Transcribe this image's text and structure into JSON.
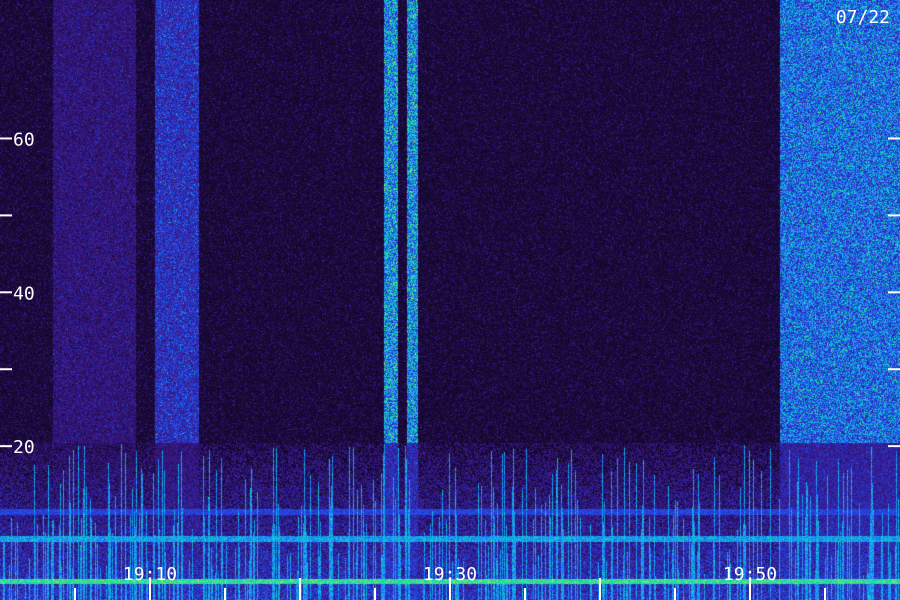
{
  "chart_data": {
    "type": "heatmap",
    "title": "",
    "date_label": "07/22",
    "xlabel": "",
    "ylabel": "",
    "y_axis": {
      "range": [
        0,
        78
      ],
      "tick_labels": [
        "60",
        "40",
        "20"
      ],
      "tick_values": [
        60,
        50,
        40,
        30,
        20
      ]
    },
    "x_axis": {
      "range": [
        "19:00",
        "20:00"
      ],
      "tick_labels": [
        "19:10",
        "19:30",
        "19:50"
      ],
      "tick_label_values": [
        10,
        30,
        50
      ],
      "major_tick_values": [
        10,
        20,
        30,
        40,
        50
      ],
      "minor_tick_values": [
        5,
        15,
        25,
        35,
        45,
        55
      ]
    },
    "colormap": [
      "#000000",
      "#1a0a3a",
      "#3a1580",
      "#2a30c0",
      "#2060ff",
      "#10c8d8",
      "#30e080",
      "#d0ff40"
    ],
    "intensity_bands": [
      {
        "time_start": 3.5,
        "time_end": 9.0,
        "level": 0.35
      },
      {
        "time_start": 10.3,
        "time_end": 13.2,
        "level": 0.55
      },
      {
        "time_start": 25.6,
        "time_end": 26.5,
        "level": 0.85
      },
      {
        "time_start": 27.1,
        "time_end": 27.8,
        "level": 0.85
      },
      {
        "time_start": 52.0,
        "time_end": 60.0,
        "level": 0.75
      }
    ],
    "horizontal_lines": [
      {
        "freq": 11.5,
        "level": 0.55
      },
      {
        "freq": 8.0,
        "level": 0.75
      },
      {
        "freq": 2.5,
        "level": 0.95
      }
    ]
  }
}
